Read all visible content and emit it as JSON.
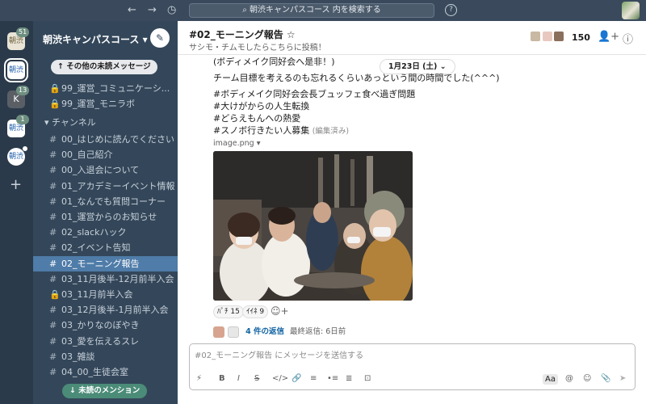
{
  "topbar": {
    "back": "←",
    "forward": "→",
    "history": "◷",
    "search_placeholder": "朝渋キャンパスコース 内を検索する",
    "help": "?"
  },
  "rail": {
    "workspaces": [
      {
        "label": "朝渋",
        "badge": "51"
      },
      {
        "label": "朝渋",
        "badge": ""
      },
      {
        "label": "K",
        "badge": "13"
      },
      {
        "label": "朝渋",
        "badge": "1"
      },
      {
        "label": "朝渋",
        "badge": ""
      }
    ],
    "add": "+"
  },
  "sidebar": {
    "workspace_name": "朝渋キャンパスコース ▾",
    "compose_icon": "✎",
    "unread_pill": "↑ その他の未読メッセージ",
    "private_items": [
      "99_運営_コミュニケーシ...",
      "99_運営_モニラボ"
    ],
    "channels_label": "▾ チャンネル",
    "channels": [
      {
        "prefix": "#",
        "name": "00_はじめに読んでください"
      },
      {
        "prefix": "#",
        "name": "00_自己紹介"
      },
      {
        "prefix": "#",
        "name": "00_入退会について"
      },
      {
        "prefix": "#",
        "name": "01_アカデミーイベント情報"
      },
      {
        "prefix": "#",
        "name": "01_なんでも質問コーナー"
      },
      {
        "prefix": "#",
        "name": "01_運営からのお知らせ"
      },
      {
        "prefix": "#",
        "name": "02_slackハック"
      },
      {
        "prefix": "#",
        "name": "02_イベント告知"
      },
      {
        "prefix": "#",
        "name": "02_モーニング報告"
      },
      {
        "prefix": "#",
        "name": "03_11月後半-12月前半入会"
      },
      {
        "prefix": "🔒",
        "name": "03_11月前半入会"
      },
      {
        "prefix": "#",
        "name": "03_12月後半-1月前半入会"
      },
      {
        "prefix": "#",
        "name": "03_かりなのぼやき"
      },
      {
        "prefix": "#",
        "name": "03_愛を伝えるスレ"
      },
      {
        "prefix": "#",
        "name": "03_雑談"
      },
      {
        "prefix": "#",
        "name": "04_00_生徒会室"
      }
    ],
    "active_channel": "02_モーニング報告",
    "mention_pill": "↓ 未読のメンション"
  },
  "header": {
    "title": "#02_モーニング報告 ☆",
    "subtitle": "サシモ・チムモしたらこちらに投稿！",
    "member_count": "150",
    "add_member_icon": "👤+",
    "info_icon": "ⓘ"
  },
  "message": {
    "lines_top": [
      "(ボディメイク同好会へ是非！)",
      "チーム目標を考えるのも忘れるくらいあっという間の時間でした(^^^)"
    ],
    "hashtags": [
      "#ボディメイク同好会会長ブュッフェ食べ過ぎ問題",
      "#大けがからの人生転換",
      "#どらえもんへの熱愛",
      "#スノボ行きたい人募集"
    ],
    "edited": "(編集済み)",
    "date_pill": "1月23日 (土) ⌄",
    "file_name": "image.png ▾",
    "reactions": [
      {
        "emoji": "ﾊﾟﾁ",
        "count": "15"
      },
      {
        "emoji": "ｲｲﾈ",
        "count": "9"
      }
    ],
    "add_reaction": "☺+",
    "thread_replies": "4 件の返信",
    "thread_last": "最終返信: 6日前"
  },
  "composer": {
    "placeholder": "#02_モーニング報告 にメッセージを送信する",
    "tools": [
      "⚡",
      "B",
      "I",
      "S",
      "</>",
      "🔗",
      "≡",
      "•≡",
      "≣",
      "⊡"
    ],
    "right_tools": [
      "Aa",
      "@",
      "☺",
      "📎",
      "➤"
    ]
  },
  "colors": {
    "sidebar_bg": "#34475a",
    "rail_bg": "#2b3a4a",
    "active_channel": "#4f7ca8",
    "topbar_bg": "#3a4a5c"
  }
}
